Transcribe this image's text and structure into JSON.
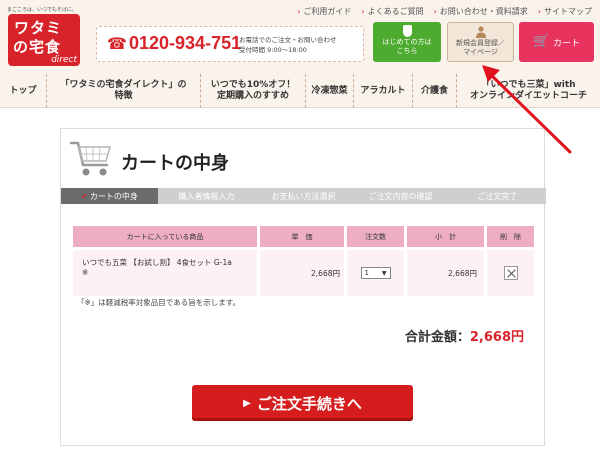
{
  "header": {
    "tagline": "まごころは、いつでもそばに。",
    "logo_line1": "ワタミ",
    "logo_line2": "の宅食",
    "logo_line3": "direct",
    "top_links": [
      "ご利用ガイド",
      "よくあるご質問",
      "お問い合わせ・資料請求",
      "サイトマップ"
    ],
    "phone_icon": "phone-icon",
    "phone_number": "0120-934-751",
    "phone_note1": "お電話でのご注文・お問い合わせ",
    "phone_note2": "受付時間 9:00〜18:00",
    "first_button": [
      "はじめての方は",
      "こちら"
    ],
    "member_button": [
      "新規会員登録／",
      "マイページ"
    ],
    "cart_button": "カート"
  },
  "nav": {
    "items": [
      [
        "トップ"
      ],
      [
        "「ワタミの宅食ダイレクト」の",
        "特徴"
      ],
      [
        "いつでも10%オフ！",
        "定期購入のすすめ"
      ],
      [
        "冷凍惣菜"
      ],
      [
        "アラカルト"
      ],
      [
        "介護食"
      ],
      [
        "「いつでも三菜」with",
        "オンラインダイエットコーチ"
      ]
    ]
  },
  "main": {
    "title": "カートの中身",
    "steps": [
      "カートの中身",
      "購入者情報入力",
      "お支払い方法選択",
      "ご注文内容の確認",
      "ご注文完了"
    ],
    "table": {
      "headers": [
        "カートに入っている商品",
        "単　価",
        "注文数",
        "小　計",
        "削　除"
      ],
      "rows": [
        {
          "name": "いつでも五菜 【お試し割】 4食セット G-1a",
          "mark": "※",
          "unit_price": "2,668円",
          "quantity": "1",
          "subtotal": "2,668円"
        }
      ]
    },
    "note": "「※」は軽減税率対象品目である旨を示します。",
    "total_label": "合計金額：",
    "total_value": "2,668円",
    "checkout_button": "ご注文手続きへ"
  },
  "colors": {
    "brand_red": "#d8232a",
    "green": "#4dab2f",
    "pink": "#e8335e",
    "table_header": "#ecaec0",
    "annotation_arrow": "#e0141e"
  }
}
